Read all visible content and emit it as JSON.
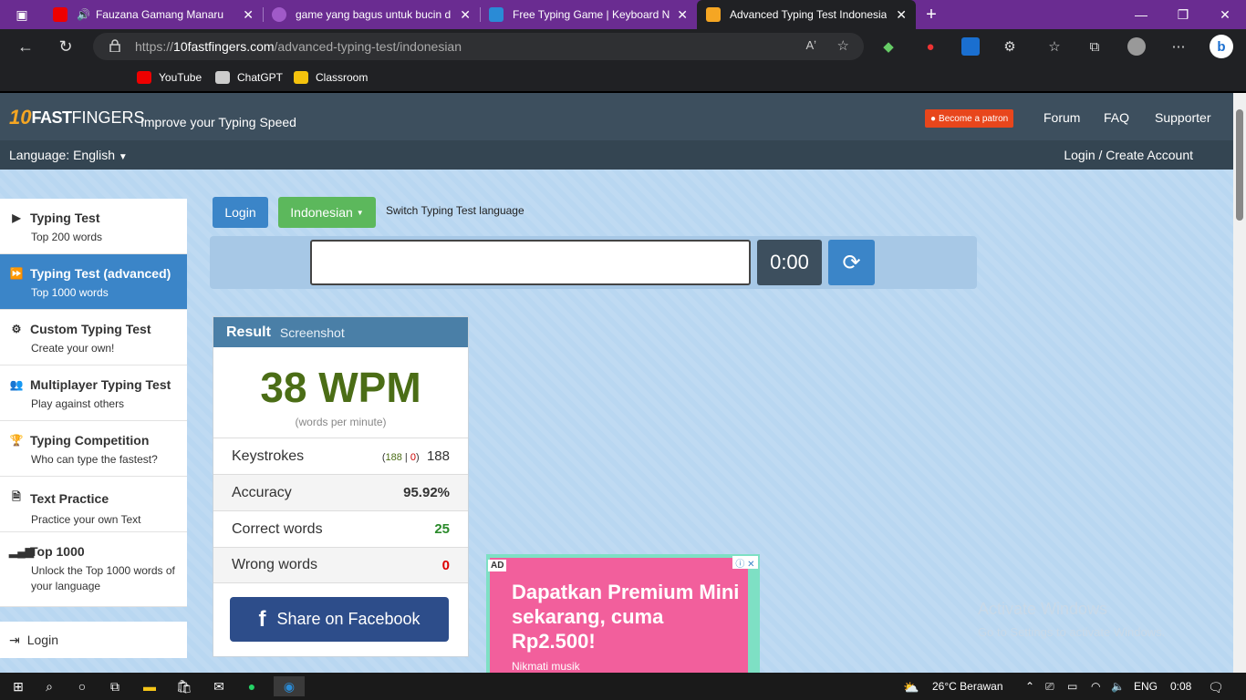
{
  "tabs": [
    {
      "title": "Fauzana Gamang Manarua..."
    },
    {
      "title": "game yang bagus untuk bucin d"
    },
    {
      "title": "Free Typing Game | Keyboard N"
    },
    {
      "title": "Advanced Typing Test Indonesia"
    }
  ],
  "url": {
    "prefix": "https://",
    "host": "10fastfingers.com",
    "path": "/advanced-typing-test/indonesian"
  },
  "bookmarks": [
    "YouTube",
    "ChatGPT",
    "Classroom"
  ],
  "site": {
    "logo_ten": "10",
    "logo_fast": "FAST",
    "logo_fingers": "FINGERS",
    "tagline": "Improve your Typing Speed",
    "patron": "Become a patron",
    "nav": [
      "Forum",
      "FAQ",
      "Supporter"
    ],
    "language": "Language: English",
    "login_create": "Login / Create Account"
  },
  "sidebar": [
    {
      "title": "Typing Test",
      "sub": "Top 200 words",
      "icon": "play-icon"
    },
    {
      "title": "Typing Test (advanced)",
      "sub": "Top 1000 words",
      "icon": "fast-forward-icon"
    },
    {
      "title": "Custom Typing Test",
      "sub": "Create your own!",
      "icon": "cogs-icon"
    },
    {
      "title": "Multiplayer Typing Test",
      "sub": "Play against others",
      "icon": "users-icon"
    },
    {
      "title": "Typing Competition",
      "sub": "Who can type the fastest?",
      "icon": "trophy-icon"
    },
    {
      "title": "Text Practice",
      "sub": "Practice your own Text",
      "icon": "document-icon"
    },
    {
      "title": "Top 1000",
      "sub": "Unlock the Top 1000 words of your language",
      "icon": "signal-icon"
    }
  ],
  "sidebar_login": "Login",
  "controls": {
    "login": "Login",
    "language": "Indonesian",
    "switch": "Switch Typing Test language",
    "timer": "0:00"
  },
  "result": {
    "title": "Result",
    "screenshot": "Screenshot",
    "wpm": "38 WPM",
    "wpm_sub": "(words per minute)",
    "keystrokes_label": "Keystrokes",
    "keystrokes_correct": "188",
    "keystrokes_wrong": "0",
    "keystrokes_total": "188",
    "accuracy_label": "Accuracy",
    "accuracy": "95.92%",
    "correct_label": "Correct words",
    "correct": "25",
    "wrong_label": "Wrong words",
    "wrong": "0",
    "share": "Share on Facebook"
  },
  "ad": {
    "label": "AD",
    "headline": "Dapatkan Premium Mini sekarang, cuma Rp2.500!",
    "sub": "Nikmati musik"
  },
  "watermark": {
    "line1": "Activate Windows",
    "line2": "Go to Settings to activate Windows."
  },
  "taskbar": {
    "weather": "26°C  Berawan",
    "lang": "ENG",
    "time": "0:08"
  }
}
